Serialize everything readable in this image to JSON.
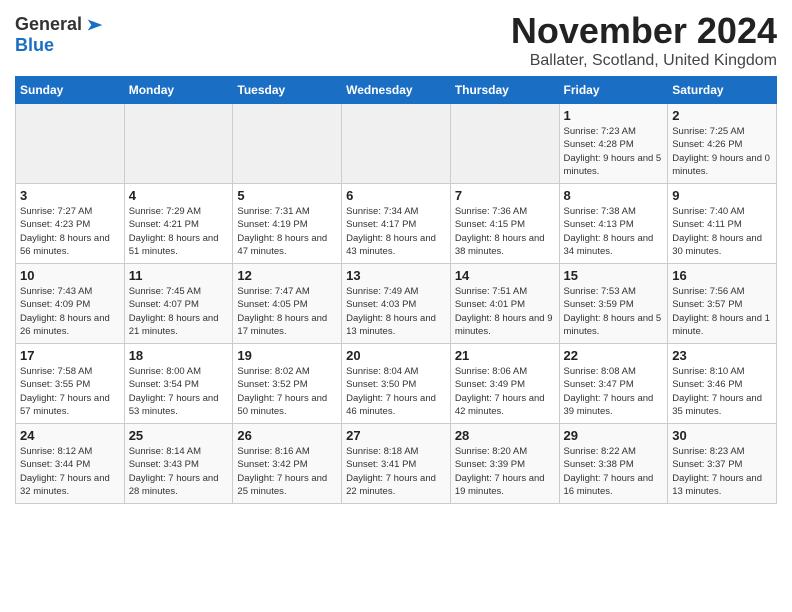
{
  "header": {
    "logo_line1": "General",
    "logo_line2": "Blue",
    "month_title": "November 2024",
    "location": "Ballater, Scotland, United Kingdom"
  },
  "days_of_week": [
    "Sunday",
    "Monday",
    "Tuesday",
    "Wednesday",
    "Thursday",
    "Friday",
    "Saturday"
  ],
  "weeks": [
    [
      {
        "day": "",
        "sunrise": "",
        "sunset": "",
        "daylight": "",
        "empty": true
      },
      {
        "day": "",
        "sunrise": "",
        "sunset": "",
        "daylight": "",
        "empty": true
      },
      {
        "day": "",
        "sunrise": "",
        "sunset": "",
        "daylight": "",
        "empty": true
      },
      {
        "day": "",
        "sunrise": "",
        "sunset": "",
        "daylight": "",
        "empty": true
      },
      {
        "day": "",
        "sunrise": "",
        "sunset": "",
        "daylight": "",
        "empty": true
      },
      {
        "day": "1",
        "sunrise": "Sunrise: 7:23 AM",
        "sunset": "Sunset: 4:28 PM",
        "daylight": "Daylight: 9 hours and 5 minutes.",
        "empty": false
      },
      {
        "day": "2",
        "sunrise": "Sunrise: 7:25 AM",
        "sunset": "Sunset: 4:26 PM",
        "daylight": "Daylight: 9 hours and 0 minutes.",
        "empty": false
      }
    ],
    [
      {
        "day": "3",
        "sunrise": "Sunrise: 7:27 AM",
        "sunset": "Sunset: 4:23 PM",
        "daylight": "Daylight: 8 hours and 56 minutes.",
        "empty": false
      },
      {
        "day": "4",
        "sunrise": "Sunrise: 7:29 AM",
        "sunset": "Sunset: 4:21 PM",
        "daylight": "Daylight: 8 hours and 51 minutes.",
        "empty": false
      },
      {
        "day": "5",
        "sunrise": "Sunrise: 7:31 AM",
        "sunset": "Sunset: 4:19 PM",
        "daylight": "Daylight: 8 hours and 47 minutes.",
        "empty": false
      },
      {
        "day": "6",
        "sunrise": "Sunrise: 7:34 AM",
        "sunset": "Sunset: 4:17 PM",
        "daylight": "Daylight: 8 hours and 43 minutes.",
        "empty": false
      },
      {
        "day": "7",
        "sunrise": "Sunrise: 7:36 AM",
        "sunset": "Sunset: 4:15 PM",
        "daylight": "Daylight: 8 hours and 38 minutes.",
        "empty": false
      },
      {
        "day": "8",
        "sunrise": "Sunrise: 7:38 AM",
        "sunset": "Sunset: 4:13 PM",
        "daylight": "Daylight: 8 hours and 34 minutes.",
        "empty": false
      },
      {
        "day": "9",
        "sunrise": "Sunrise: 7:40 AM",
        "sunset": "Sunset: 4:11 PM",
        "daylight": "Daylight: 8 hours and 30 minutes.",
        "empty": false
      }
    ],
    [
      {
        "day": "10",
        "sunrise": "Sunrise: 7:43 AM",
        "sunset": "Sunset: 4:09 PM",
        "daylight": "Daylight: 8 hours and 26 minutes.",
        "empty": false
      },
      {
        "day": "11",
        "sunrise": "Sunrise: 7:45 AM",
        "sunset": "Sunset: 4:07 PM",
        "daylight": "Daylight: 8 hours and 21 minutes.",
        "empty": false
      },
      {
        "day": "12",
        "sunrise": "Sunrise: 7:47 AM",
        "sunset": "Sunset: 4:05 PM",
        "daylight": "Daylight: 8 hours and 17 minutes.",
        "empty": false
      },
      {
        "day": "13",
        "sunrise": "Sunrise: 7:49 AM",
        "sunset": "Sunset: 4:03 PM",
        "daylight": "Daylight: 8 hours and 13 minutes.",
        "empty": false
      },
      {
        "day": "14",
        "sunrise": "Sunrise: 7:51 AM",
        "sunset": "Sunset: 4:01 PM",
        "daylight": "Daylight: 8 hours and 9 minutes.",
        "empty": false
      },
      {
        "day": "15",
        "sunrise": "Sunrise: 7:53 AM",
        "sunset": "Sunset: 3:59 PM",
        "daylight": "Daylight: 8 hours and 5 minutes.",
        "empty": false
      },
      {
        "day": "16",
        "sunrise": "Sunrise: 7:56 AM",
        "sunset": "Sunset: 3:57 PM",
        "daylight": "Daylight: 8 hours and 1 minute.",
        "empty": false
      }
    ],
    [
      {
        "day": "17",
        "sunrise": "Sunrise: 7:58 AM",
        "sunset": "Sunset: 3:55 PM",
        "daylight": "Daylight: 7 hours and 57 minutes.",
        "empty": false
      },
      {
        "day": "18",
        "sunrise": "Sunrise: 8:00 AM",
        "sunset": "Sunset: 3:54 PM",
        "daylight": "Daylight: 7 hours and 53 minutes.",
        "empty": false
      },
      {
        "day": "19",
        "sunrise": "Sunrise: 8:02 AM",
        "sunset": "Sunset: 3:52 PM",
        "daylight": "Daylight: 7 hours and 50 minutes.",
        "empty": false
      },
      {
        "day": "20",
        "sunrise": "Sunrise: 8:04 AM",
        "sunset": "Sunset: 3:50 PM",
        "daylight": "Daylight: 7 hours and 46 minutes.",
        "empty": false
      },
      {
        "day": "21",
        "sunrise": "Sunrise: 8:06 AM",
        "sunset": "Sunset: 3:49 PM",
        "daylight": "Daylight: 7 hours and 42 minutes.",
        "empty": false
      },
      {
        "day": "22",
        "sunrise": "Sunrise: 8:08 AM",
        "sunset": "Sunset: 3:47 PM",
        "daylight": "Daylight: 7 hours and 39 minutes.",
        "empty": false
      },
      {
        "day": "23",
        "sunrise": "Sunrise: 8:10 AM",
        "sunset": "Sunset: 3:46 PM",
        "daylight": "Daylight: 7 hours and 35 minutes.",
        "empty": false
      }
    ],
    [
      {
        "day": "24",
        "sunrise": "Sunrise: 8:12 AM",
        "sunset": "Sunset: 3:44 PM",
        "daylight": "Daylight: 7 hours and 32 minutes.",
        "empty": false
      },
      {
        "day": "25",
        "sunrise": "Sunrise: 8:14 AM",
        "sunset": "Sunset: 3:43 PM",
        "daylight": "Daylight: 7 hours and 28 minutes.",
        "empty": false
      },
      {
        "day": "26",
        "sunrise": "Sunrise: 8:16 AM",
        "sunset": "Sunset: 3:42 PM",
        "daylight": "Daylight: 7 hours and 25 minutes.",
        "empty": false
      },
      {
        "day": "27",
        "sunrise": "Sunrise: 8:18 AM",
        "sunset": "Sunset: 3:41 PM",
        "daylight": "Daylight: 7 hours and 22 minutes.",
        "empty": false
      },
      {
        "day": "28",
        "sunrise": "Sunrise: 8:20 AM",
        "sunset": "Sunset: 3:39 PM",
        "daylight": "Daylight: 7 hours and 19 minutes.",
        "empty": false
      },
      {
        "day": "29",
        "sunrise": "Sunrise: 8:22 AM",
        "sunset": "Sunset: 3:38 PM",
        "daylight": "Daylight: 7 hours and 16 minutes.",
        "empty": false
      },
      {
        "day": "30",
        "sunrise": "Sunrise: 8:23 AM",
        "sunset": "Sunset: 3:37 PM",
        "daylight": "Daylight: 7 hours and 13 minutes.",
        "empty": false
      }
    ]
  ]
}
